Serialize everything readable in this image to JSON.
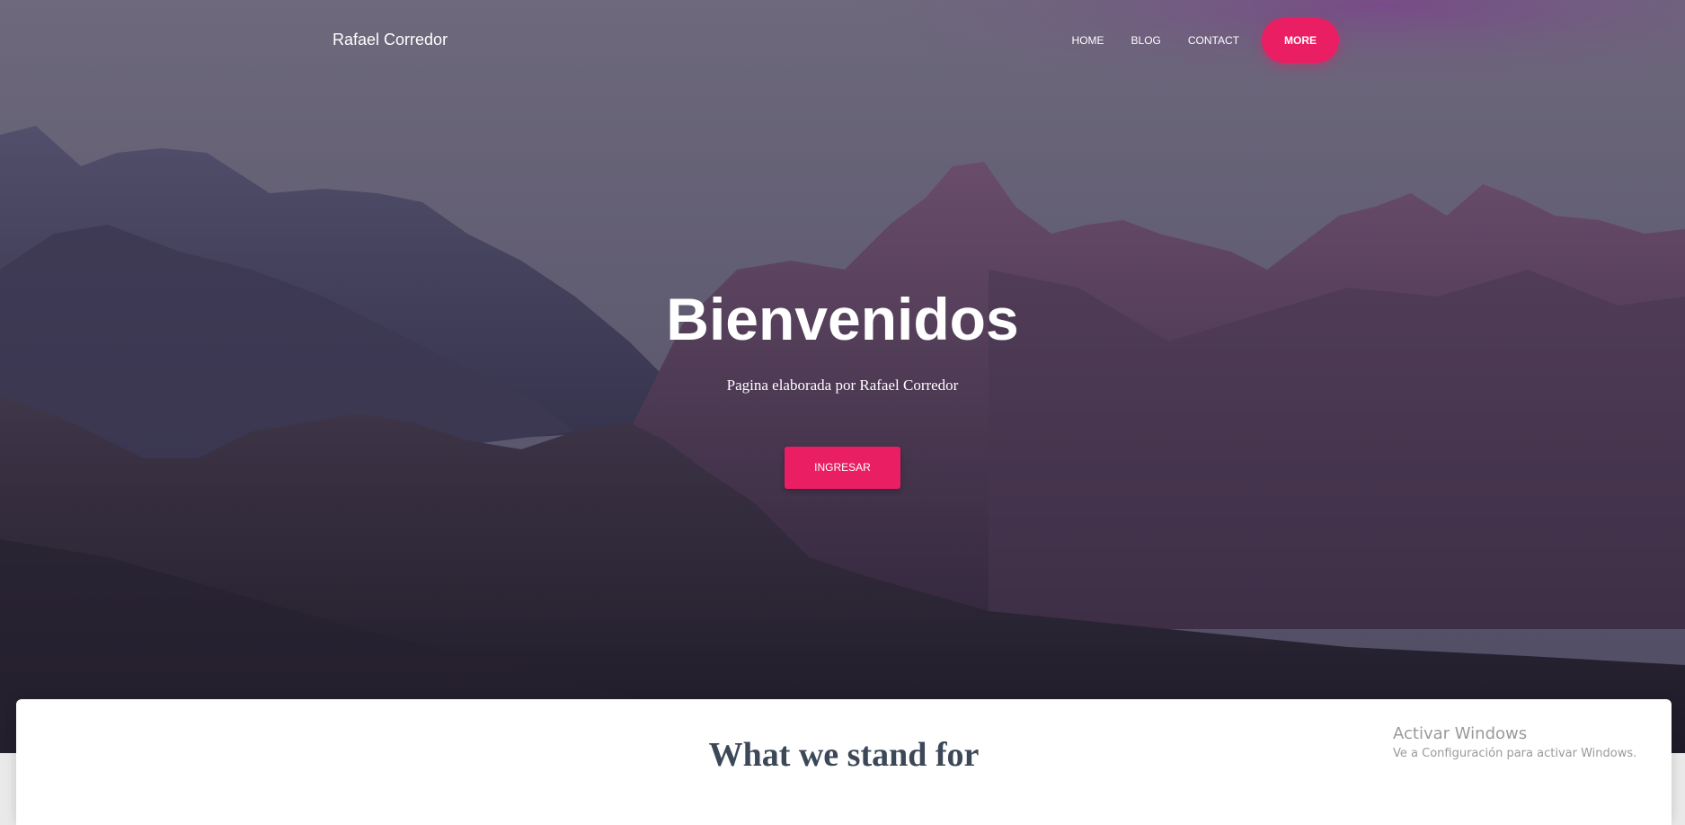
{
  "navbar": {
    "brand": "Rafael Corredor",
    "links": [
      "HOME",
      "BLOG",
      "CONTACT"
    ],
    "more_label": "MORE"
  },
  "hero": {
    "title": "Bienvenidos",
    "subtitle": "Pagina elaborada por Rafael Corredor",
    "button_label": "INGRESAR"
  },
  "section": {
    "title": "What we stand for"
  },
  "watermark": {
    "title": "Activar Windows",
    "subtitle": "Ve a Configuración para activar Windows."
  },
  "colors": {
    "accent": "#e91e63",
    "heading": "#3c4858"
  }
}
